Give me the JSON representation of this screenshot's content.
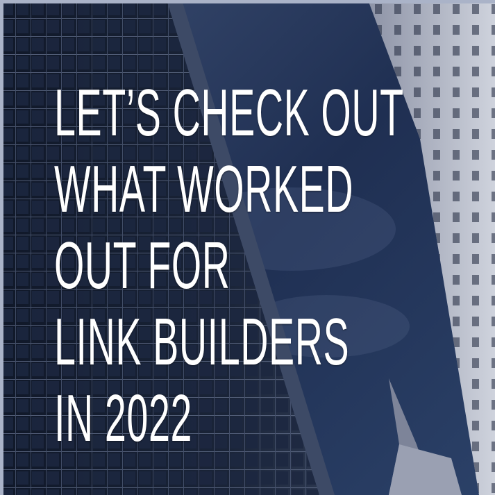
{
  "headline": {
    "lines": [
      "LET’S CHECK OUT",
      "WHAT WORKED",
      "OUT FOR",
      "LINK BUILDERS",
      "IN 2022"
    ]
  },
  "colors": {
    "sky": "#1f2f52",
    "building_dark": "#0f1626",
    "building_light": "#c9cdd8",
    "text": "#ffffff"
  }
}
